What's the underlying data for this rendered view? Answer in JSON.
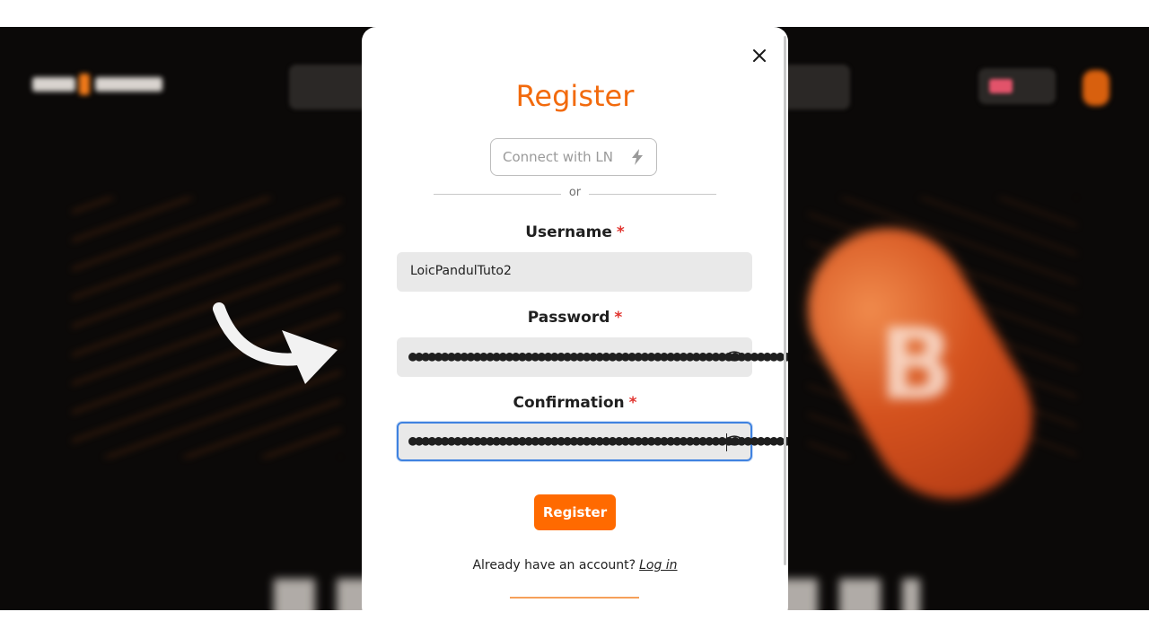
{
  "modal": {
    "title": "Register",
    "ln_button_label": "Connect with LN",
    "separator_text": "or",
    "fields": {
      "username": {
        "label": "Username",
        "required_mark": "*",
        "value": "LoicPandulTuto2"
      },
      "password": {
        "label": "Password",
        "required_mark": "*",
        "masked_value": "●●●●●●●●●●●●●●●●●●●●●●●●●●●●●●●●●●●●●●●●●●●●●●●●●●●●●●●●●●●●●●●●●●●●●●●●●●●●●●●●●"
      },
      "confirmation": {
        "label": "Confirmation",
        "required_mark": "*",
        "masked_value": "●●●●●●●●●●●●●●●●●●●●●●●●●●●●●●●●●●●●●●●●●●●●●●●●●●●●●●●●●●●●●●●●●●●●●●●●●●●●●●●●●"
      }
    },
    "submit_label": "Register",
    "login_prompt": "Already have an account?",
    "login_link": "Log in"
  },
  "icons": {
    "close": "close-icon",
    "bolt": "lightning-bolt-icon",
    "eye": "eye-icon",
    "arrow": "curved-arrow-icon"
  },
  "colors": {
    "accent": "#ff6a00",
    "title": "#f26a0d",
    "required": "#e1342f",
    "focus_border": "#3f82e0",
    "backdrop": "#0b0908"
  }
}
